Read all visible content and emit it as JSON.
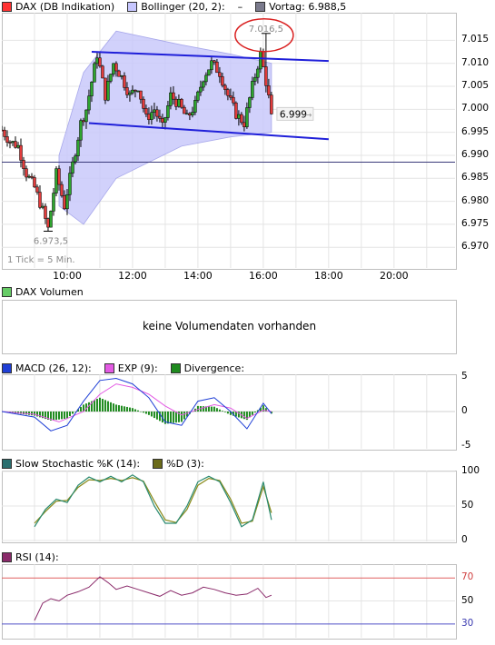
{
  "legends": {
    "price": [
      {
        "label": "DAX (DB Indikation)",
        "color": "#ff3333"
      },
      {
        "label": "Bollinger (20, 2):",
        "color": "#c7c7ff"
      },
      {
        "label": "–",
        "color": ""
      },
      {
        "label": "Vortag: 6.988,5",
        "color": "#7a7a8c"
      }
    ],
    "volume": [
      {
        "label": "DAX Volumen",
        "color": "#66cc66"
      }
    ],
    "macd": [
      {
        "label": "MACD (26, 12):",
        "color": "#1f3fd6"
      },
      {
        "label": "EXP (9):",
        "color": "#e35ae3"
      },
      {
        "label": "Divergence:",
        "color": "#1e8a1e"
      }
    ],
    "stoch": [
      {
        "label": "Slow Stochastic %K (14):",
        "color": "#2a6f6f"
      },
      {
        "label": "%D (3):",
        "color": "#6b6b1a"
      }
    ],
    "rsi": [
      {
        "label": "RSI (14):",
        "color": "#8a2a6a"
      }
    ]
  },
  "volume_message": "keine Volumendaten vorhanden",
  "tick_note": "1 Tick = 5 Min.",
  "annotations": {
    "high_label": "7.016,5",
    "low_label": "6.973,5",
    "last_price": "6.999",
    "last_arrow": "→"
  },
  "chart_data": [
    {
      "type": "candlestick",
      "title": "DAX (DB Indikation)",
      "interval": "5 Min.",
      "x_ticks": [
        "10:00",
        "12:00",
        "14:00",
        "16:00",
        "18:00",
        "20:00"
      ],
      "y_ticks": [
        "6.970",
        "6.975",
        "6.980",
        "6.985",
        "6.990",
        "6.995",
        "7.000",
        "7.005",
        "7.010",
        "7.015"
      ],
      "ylim": [
        6965.5,
        7021
      ],
      "xlim": [
        "08:00",
        "21:52"
      ],
      "previous_close": 6988.5,
      "day_high": 7016.5,
      "day_low": 6973.5,
      "last": 6999,
      "close_path": [
        [
          "08:00",
          6995.5
        ],
        [
          "08:15",
          6993
        ],
        [
          "08:30",
          6992
        ],
        [
          "08:45",
          6986
        ],
        [
          "09:00",
          6983
        ],
        [
          "09:15",
          6978
        ],
        [
          "09:25",
          6974
        ],
        [
          "09:40",
          6986
        ],
        [
          "09:55",
          6979
        ],
        [
          "10:05",
          6985
        ],
        [
          "10:15",
          6991
        ],
        [
          "10:25",
          6997
        ],
        [
          "10:35",
          7000
        ],
        [
          "10:45",
          7006
        ],
        [
          "10:55",
          7012
        ],
        [
          "11:10",
          7003
        ],
        [
          "11:25",
          7010
        ],
        [
          "11:40",
          7007
        ],
        [
          "11:55",
          7003
        ],
        [
          "12:10",
          7005
        ],
        [
          "12:25",
          6998
        ],
        [
          "12:40",
          7000
        ],
        [
          "12:55",
          6996
        ],
        [
          "13:10",
          7003
        ],
        [
          "13:25",
          7001
        ],
        [
          "13:40",
          6998
        ],
        [
          "13:55",
          7001
        ],
        [
          "14:10",
          7007
        ],
        [
          "14:25",
          7010
        ],
        [
          "14:40",
          7008
        ],
        [
          "14:55",
          7003
        ],
        [
          "15:10",
          6999
        ],
        [
          "15:25",
          6997
        ],
        [
          "15:40",
          7005
        ],
        [
          "15:55",
          7012
        ],
        [
          "16:05",
          7006
        ],
        [
          "16:15",
          6999
        ]
      ],
      "bollinger_upper": [
        [
          "09:45",
          6990
        ],
        [
          "10:30",
          7008
        ],
        [
          "11:30",
          7017
        ],
        [
          "13:30",
          7014
        ],
        [
          "15:00",
          7012
        ],
        [
          "16:15",
          7010
        ]
      ],
      "bollinger_lower": [
        [
          "09:45",
          6979
        ],
        [
          "10:30",
          6975
        ],
        [
          "11:30",
          6985
        ],
        [
          "13:30",
          6992
        ],
        [
          "15:00",
          6994
        ],
        [
          "16:15",
          6995
        ]
      ],
      "trendlines": [
        {
          "points": [
            [
              "10:45",
              7012.5
            ],
            [
              "18:00",
              7010.5
            ]
          ]
        },
        {
          "points": [
            [
              "10:40",
              6997
            ],
            [
              "18:00",
              6993.5
            ]
          ]
        }
      ]
    },
    {
      "type": "bar",
      "title": "DAX Volumen",
      "values": [],
      "note": "keine Volumendaten vorhanden"
    },
    {
      "type": "line",
      "title": "MACD (26, 12)",
      "y_ticks": [
        "5",
        "0",
        "-5"
      ],
      "ylim": [
        -5,
        5
      ],
      "series": [
        {
          "name": "MACD (26, 12)",
          "points": [
            [
              "08:00",
              0
            ],
            [
              "09:00",
              -0.8
            ],
            [
              "09:30",
              -2.8
            ],
            [
              "10:00",
              -2
            ],
            [
              "10:30",
              1.5
            ],
            [
              "11:00",
              4.5
            ],
            [
              "11:30",
              4.8
            ],
            [
              "12:00",
              4
            ],
            [
              "12:30",
              2
            ],
            [
              "13:00",
              -1.5
            ],
            [
              "13:30",
              -2
            ],
            [
              "14:00",
              1.5
            ],
            [
              "14:30",
              2
            ],
            [
              "15:00",
              0
            ],
            [
              "15:30",
              -2.5
            ],
            [
              "16:00",
              1.2
            ],
            [
              "16:15",
              -0.3
            ]
          ]
        },
        {
          "name": "EXP (9)",
          "points": [
            [
              "08:00",
              0
            ],
            [
              "09:00",
              -0.4
            ],
            [
              "09:45",
              -1.5
            ],
            [
              "10:30",
              0
            ],
            [
              "11:00",
              2.5
            ],
            [
              "11:30",
              4
            ],
            [
              "12:00",
              3.5
            ],
            [
              "12:30",
              2.5
            ],
            [
              "13:00",
              0.8
            ],
            [
              "13:30",
              -0.5
            ],
            [
              "14:00",
              0.3
            ],
            [
              "14:30",
              1
            ],
            [
              "15:00",
              0.5
            ],
            [
              "15:30",
              -1
            ],
            [
              "16:00",
              0.2
            ],
            [
              "16:15",
              0
            ]
          ]
        },
        {
          "name": "Divergence",
          "points": [
            [
              "08:00",
              0
            ],
            [
              "09:00",
              -0.6
            ],
            [
              "09:30",
              -1.3
            ],
            [
              "10:00",
              -1
            ],
            [
              "10:30",
              1
            ],
            [
              "11:00",
              2
            ],
            [
              "11:30",
              1
            ],
            [
              "12:00",
              0.5
            ],
            [
              "12:30",
              -0.5
            ],
            [
              "13:00",
              -1.8
            ],
            [
              "13:30",
              -1.5
            ],
            [
              "14:00",
              0.8
            ],
            [
              "14:30",
              0.7
            ],
            [
              "15:00",
              -0.5
            ],
            [
              "15:30",
              -1.2
            ],
            [
              "16:00",
              0.9
            ],
            [
              "16:15",
              -0.3
            ]
          ]
        }
      ]
    },
    {
      "type": "line",
      "title": "Slow Stochastic %K (14)",
      "y_ticks": [
        "100",
        "50",
        "0"
      ],
      "ylim": [
        0,
        100
      ],
      "series": [
        {
          "name": "Slow Stochastic %K (14)",
          "points": [
            [
              "09:00",
              20
            ],
            [
              "09:20",
              45
            ],
            [
              "09:40",
              60
            ],
            [
              "10:00",
              55
            ],
            [
              "10:20",
              80
            ],
            [
              "10:40",
              92
            ],
            [
              "11:00",
              85
            ],
            [
              "11:20",
              93
            ],
            [
              "11:40",
              85
            ],
            [
              "12:00",
              95
            ],
            [
              "12:20",
              85
            ],
            [
              "12:40",
              50
            ],
            [
              "13:00",
              25
            ],
            [
              "13:20",
              25
            ],
            [
              "13:40",
              50
            ],
            [
              "14:00",
              85
            ],
            [
              "14:20",
              93
            ],
            [
              "14:40",
              85
            ],
            [
              "15:00",
              55
            ],
            [
              "15:20",
              20
            ],
            [
              "15:40",
              30
            ],
            [
              "16:00",
              85
            ],
            [
              "16:15",
              30
            ]
          ]
        },
        {
          "name": "%D (3)",
          "points": [
            [
              "09:00",
              25
            ],
            [
              "09:20",
              42
            ],
            [
              "09:40",
              57
            ],
            [
              "10:00",
              58
            ],
            [
              "10:20",
              77
            ],
            [
              "10:40",
              88
            ],
            [
              "11:00",
              87
            ],
            [
              "11:20",
              90
            ],
            [
              "11:40",
              87
            ],
            [
              "12:00",
              91
            ],
            [
              "12:20",
              86
            ],
            [
              "12:40",
              57
            ],
            [
              "13:00",
              30
            ],
            [
              "13:20",
              26
            ],
            [
              "13:40",
              45
            ],
            [
              "14:00",
              80
            ],
            [
              "14:20",
              90
            ],
            [
              "14:40",
              87
            ],
            [
              "15:00",
              60
            ],
            [
              "15:20",
              25
            ],
            [
              "15:40",
              28
            ],
            [
              "16:00",
              78
            ],
            [
              "16:15",
              40
            ]
          ]
        }
      ]
    },
    {
      "type": "line",
      "title": "RSI (14)",
      "y_ticks": [
        "70",
        "50",
        "30"
      ],
      "ylim": [
        18,
        82
      ],
      "reference_lines": [
        70,
        30
      ],
      "series": [
        {
          "name": "RSI (14)",
          "points": [
            [
              "09:00",
              33
            ],
            [
              "09:15",
              48
            ],
            [
              "09:30",
              52
            ],
            [
              "09:45",
              50
            ],
            [
              "10:00",
              55
            ],
            [
              "10:20",
              58
            ],
            [
              "10:40",
              62
            ],
            [
              "11:00",
              71
            ],
            [
              "11:15",
              66
            ],
            [
              "11:30",
              60
            ],
            [
              "11:50",
              63
            ],
            [
              "12:10",
              60
            ],
            [
              "12:30",
              57
            ],
            [
              "12:50",
              54
            ],
            [
              "13:10",
              59
            ],
            [
              "13:30",
              55
            ],
            [
              "13:50",
              57
            ],
            [
              "14:10",
              62
            ],
            [
              "14:30",
              60
            ],
            [
              "14:50",
              57
            ],
            [
              "15:10",
              55
            ],
            [
              "15:30",
              56
            ],
            [
              "15:50",
              61
            ],
            [
              "16:05",
              53
            ],
            [
              "16:15",
              55
            ]
          ]
        }
      ]
    }
  ]
}
